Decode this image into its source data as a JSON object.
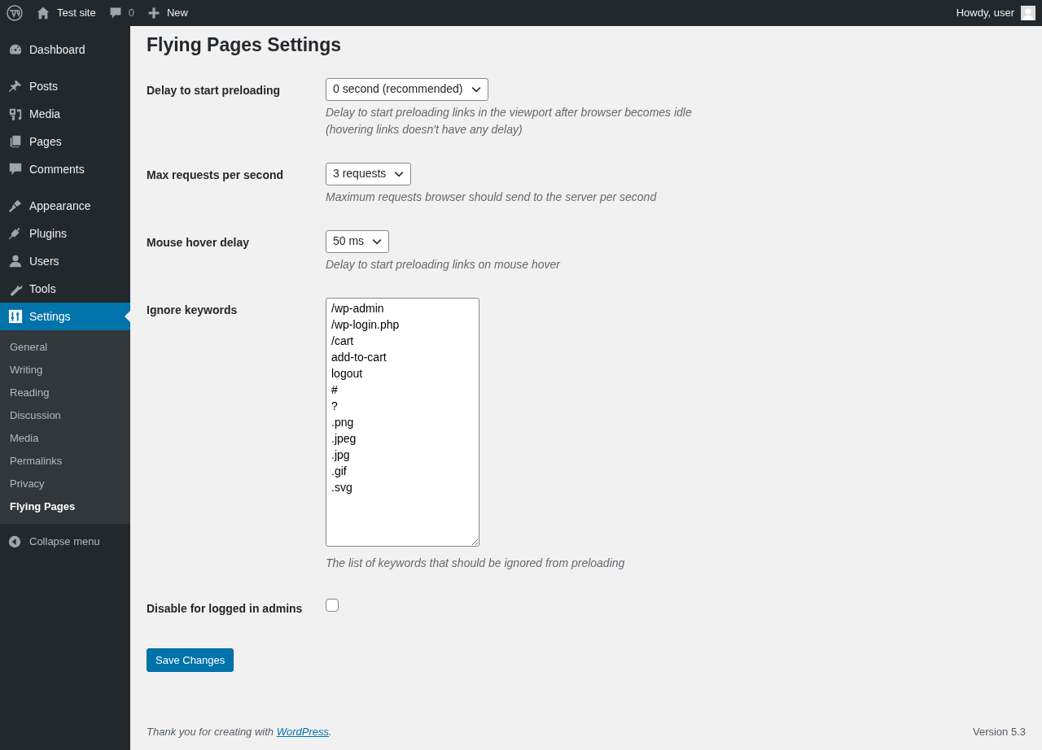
{
  "admin_bar": {
    "site": "Test site",
    "comments_count": "0",
    "new": "New",
    "greeting": "Howdy, user"
  },
  "sidebar": {
    "groups": [
      [
        {
          "label": "Dashboard",
          "selected": false
        }
      ],
      [
        {
          "label": "Posts",
          "selected": false
        },
        {
          "label": "Media",
          "selected": false
        },
        {
          "label": "Pages",
          "selected": false
        },
        {
          "label": "Comments",
          "selected": false
        }
      ],
      [
        {
          "label": "Appearance",
          "selected": false
        },
        {
          "label": "Plugins",
          "selected": false
        },
        {
          "label": "Users",
          "selected": false
        },
        {
          "label": "Tools",
          "selected": false
        },
        {
          "label": "Settings",
          "selected": true
        }
      ]
    ],
    "submenu": [
      {
        "label": "General",
        "selected": false
      },
      {
        "label": "Writing",
        "selected": false
      },
      {
        "label": "Reading",
        "selected": false
      },
      {
        "label": "Discussion",
        "selected": false
      },
      {
        "label": "Media",
        "selected": false
      },
      {
        "label": "Permalinks",
        "selected": false
      },
      {
        "label": "Privacy",
        "selected": false
      },
      {
        "label": "Flying Pages",
        "selected": true
      }
    ],
    "collapse": "Collapse menu"
  },
  "page_title": "Flying Pages Settings",
  "fields": [
    {
      "kind": "select",
      "label": "Delay to start preloading",
      "value": "0 second (recommended)",
      "description": "Delay to start preloading links in the viewport after browser becomes idle (hovering links doesn't have any delay)"
    },
    {
      "kind": "select",
      "label": "Max requests per second",
      "value": "3 requests",
      "description": "Maximum requests browser should send to the server per second"
    },
    {
      "kind": "select",
      "label": "Mouse hover delay",
      "value": "50 ms",
      "description": "Delay to start preloading links on mouse hover"
    },
    {
      "kind": "textarea",
      "label": "Ignore keywords",
      "value": "/wp-admin\n/wp-login.php\n/cart\nadd-to-cart\nlogout\n#\n?\n.png\n.jpeg\n.jpg\n.gif\n.svg",
      "description": "The list of keywords that should be ignored from preloading"
    },
    {
      "kind": "checkbox",
      "label": "Disable for logged in admins",
      "checked": false
    }
  ],
  "save_button": "Save Changes",
  "footer": {
    "text_before": "Thank you for creating with ",
    "link": "WordPress",
    "text_after": ".",
    "version": "Version 5.3"
  }
}
